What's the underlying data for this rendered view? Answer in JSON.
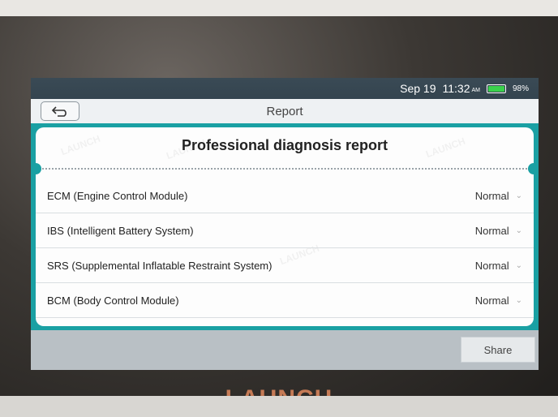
{
  "status_bar": {
    "date": "Sep 19",
    "time": "11:32",
    "ampm": "AM",
    "battery_percent": "98%",
    "battery_level": 0.98,
    "battery_color": "#3ad24c"
  },
  "header": {
    "back_icon": "back-arrow-icon",
    "title": "Report"
  },
  "report": {
    "heading": "Professional diagnosis report",
    "items": [
      {
        "name": "ECM (Engine Control Module)",
        "status": "Normal"
      },
      {
        "name": "IBS (Intelligent Battery System)",
        "status": "Normal"
      },
      {
        "name": "SRS (Supplemental Inflatable Restraint System)",
        "status": "Normal"
      },
      {
        "name": "BCM (Body Control Module)",
        "status": "Normal"
      }
    ],
    "watermark": "LAUNCH"
  },
  "footer": {
    "share_label": "Share"
  },
  "device": {
    "brand": "LAUNCH"
  },
  "colors": {
    "accent": "#1aa0a3",
    "brand": "#c57a55"
  }
}
